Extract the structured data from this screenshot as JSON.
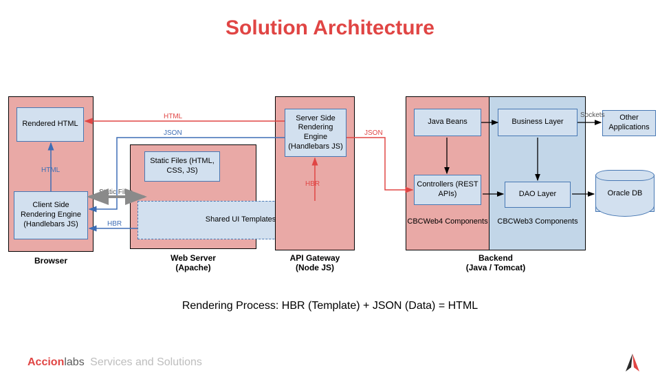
{
  "title": "Solution Architecture",
  "tiers": {
    "browser": {
      "label": "Browser"
    },
    "webserver": {
      "label": "Web Server",
      "sub": "(Apache)"
    },
    "gateway": {
      "label": "API Gateway",
      "sub": "(Node JS)"
    },
    "backend": {
      "label": "Backend",
      "sub": "(Java / Tomcat)"
    }
  },
  "nodes": {
    "rendered_html": "Rendered HTML",
    "client_engine": "Client Side Rendering Engine (Handlebars JS)",
    "static_files": "Static Files (HTML, CSS, JS)",
    "shared_templates": "Shared UI Templates",
    "server_engine": "Server Side Rendering Engine (Handlebars JS)",
    "java_beans": "Java Beans",
    "controllers": "Controllers (REST APIs)",
    "cbcweb4": "CBCWeb4 Components",
    "business_layer": "Business Layer",
    "dao_layer": "DAO Layer",
    "cbcweb3": "CBCWeb3 Components",
    "other_apps": "Other Applications",
    "oracle_db": "Oracle DB"
  },
  "edges": {
    "html_out": "HTML",
    "json_out": "JSON",
    "static_out": "Static Files",
    "html_render": "HTML",
    "hbr_gateway": "HBR",
    "json_backend": "JSON",
    "hbr_client": "HBR",
    "sockets": "Sockets"
  },
  "equation": "Rendering Process: HBR (Template) + JSON (Data) = HTML",
  "footer": {
    "brand1": "Accion",
    "brand2": "labs",
    "tag": "Services and Solutions"
  },
  "colors": {
    "accent": "#e04544",
    "blue_line": "#3d6db5",
    "node_fill": "#d2e0ef",
    "node_border": "#4677b3",
    "pink": "#e9a9a6",
    "pale_blue": "#c2d6e8"
  }
}
